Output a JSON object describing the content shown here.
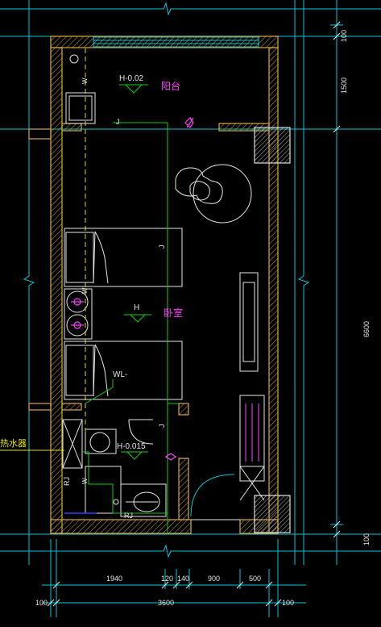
{
  "rooms": {
    "balcony": "阳台",
    "bedroom": "卧室"
  },
  "levels": {
    "balcony": "H-0.02",
    "bedroom": "H",
    "bathroom": "H-0.015"
  },
  "labels": {
    "water_heater": "热水器",
    "wl": "WL-",
    "rj1": "RJ",
    "rj2": "RJ",
    "w1": "W",
    "w2": "W",
    "w3": "W",
    "j1": "J",
    "j2": "J",
    "j3": "J"
  },
  "dimensions": {
    "bottom_row1": [
      "1940",
      "120",
      "140",
      "900",
      "500"
    ],
    "bottom_row2": [
      "100",
      "3600",
      "100"
    ],
    "right": [
      "100",
      "1500",
      "6600",
      "100"
    ]
  },
  "colors": {
    "wall": "#d4a84a",
    "dim": "#00c8d8",
    "pipe_green": "#10d010",
    "pipe_yellow": "#e0e000",
    "magenta": "#ff40ff",
    "white": "#e8e8e8"
  }
}
